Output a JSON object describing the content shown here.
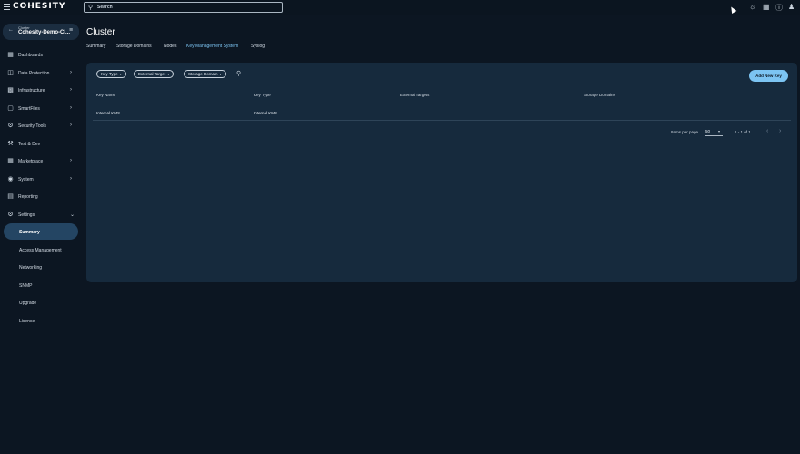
{
  "header": {
    "logo": "COHESITY",
    "search_placeholder": "Search",
    "icons": [
      "theme-sun-icon",
      "apps-grid-icon",
      "help-icon",
      "user-icon"
    ]
  },
  "sidebar": {
    "cluster_selector": {
      "label": "Cluster",
      "value": "Cohesity-Demo-Cl..."
    },
    "items": [
      {
        "label": "Dashboards",
        "icon": "dashboard-icon",
        "expandable": false
      },
      {
        "label": "Data Protection",
        "icon": "shield-icon",
        "expandable": true
      },
      {
        "label": "Infrastructure",
        "icon": "infrastructure-icon",
        "expandable": true
      },
      {
        "label": "SmartFiles",
        "icon": "folder-icon",
        "expandable": true
      },
      {
        "label": "Security Tools",
        "icon": "gear-icon",
        "expandable": true
      },
      {
        "label": "Test & Dev",
        "icon": "wrench-icon",
        "expandable": false
      },
      {
        "label": "Marketplace",
        "icon": "store-icon",
        "expandable": true
      },
      {
        "label": "System",
        "icon": "globe-icon",
        "expandable": true
      },
      {
        "label": "Reporting",
        "icon": "report-icon",
        "expandable": false
      },
      {
        "label": "Settings",
        "icon": "settings-icon",
        "expanded": true
      }
    ],
    "settings_subitems": [
      {
        "label": "Summary",
        "active": true
      },
      {
        "label": "Access Management"
      },
      {
        "label": "Networking"
      },
      {
        "label": "SNMP"
      },
      {
        "label": "Upgrade"
      },
      {
        "label": "License"
      }
    ]
  },
  "main": {
    "title": "Cluster",
    "tabs": [
      {
        "label": "Summary"
      },
      {
        "label": "Storage Domains"
      },
      {
        "label": "Nodes"
      },
      {
        "label": "Key Management System",
        "active": true
      },
      {
        "label": "Syslog"
      }
    ],
    "filters": [
      {
        "label": "Key Type"
      },
      {
        "label": "External Target"
      },
      {
        "label": "Storage Domain"
      }
    ],
    "add_button": "Add New Key",
    "table": {
      "columns": [
        "Key Name",
        "Key Type",
        "External Targets",
        "Storage Domains"
      ],
      "rows": [
        {
          "key_name": "Internal KMS",
          "key_type": "Internal KMS",
          "external_targets": "",
          "storage_domains": ""
        }
      ]
    },
    "pagination": {
      "items_per_page_label": "Items per page",
      "items_per_page": "50",
      "range": "1 - 1 of 1"
    }
  },
  "colors": {
    "background": "#0c1622",
    "card": "#162a3d",
    "accent": "#7cc4f2",
    "active_nav": "#244563"
  }
}
